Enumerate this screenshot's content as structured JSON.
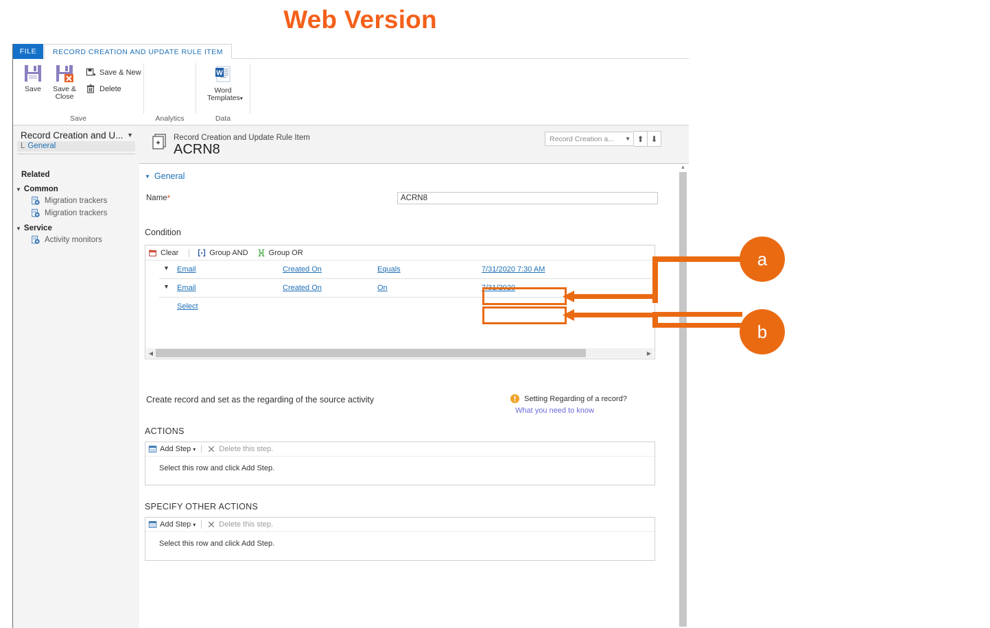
{
  "page": {
    "heading": "Web Version"
  },
  "ribbon": {
    "tabs": [
      {
        "id": "file",
        "label": "FILE"
      },
      {
        "id": "main",
        "label": "RECORD CREATION AND UPDATE RULE ITEM"
      }
    ],
    "buttons": {
      "save": "Save",
      "save_and_close_line1": "Save &",
      "save_and_close_line2": "Close",
      "save_and_new": "Save & New",
      "delete": "Delete",
      "word_templates_line1": "Word",
      "word_templates_line2": "Templates"
    },
    "groups": {
      "save": "Save",
      "analytics": "Analytics",
      "data": "Data"
    }
  },
  "nav": {
    "title": "Record Creation and U...",
    "selected_prefix": "L",
    "selected": "General",
    "related_label": "Related",
    "groups": [
      {
        "label": "Common",
        "items": [
          {
            "label": "Migration trackers",
            "icon": "record-lock-icon"
          },
          {
            "label": "Migration trackers",
            "icon": "record-lock-icon"
          }
        ]
      },
      {
        "label": "Service",
        "items": [
          {
            "label": "Activity monitors",
            "icon": "record-lock-icon"
          }
        ]
      }
    ]
  },
  "form": {
    "entity_label": "Record Creation and Update Rule Item",
    "record_title": "ACRN8",
    "lookup_value": "Record Creation a...",
    "section_general": "General",
    "name_label": "Name",
    "name_required_mark": "*",
    "name_value": "ACRN8",
    "condition_label": "Condition",
    "condition_toolbar": [
      {
        "id": "clear",
        "label": "Clear",
        "icon": "clear-icon"
      },
      {
        "id": "group-and",
        "label": "Group AND",
        "icon": "group-and-icon"
      },
      {
        "id": "group-or",
        "label": "Group OR",
        "icon": "group-or-icon"
      }
    ],
    "condition_rows": [
      {
        "entity": "Email",
        "field": "Created On",
        "operator": "Equals",
        "value": "7/31/2020 7:30 AM"
      },
      {
        "entity": "Email",
        "field": "Created On",
        "operator": "On",
        "value": "7/31/2020"
      }
    ],
    "condition_select_row": "Select",
    "regarding_text": "Create record and set as the regarding of the source activity",
    "warning_text": "Setting Regarding of a record?",
    "warning_link": "What you need to know",
    "actions_heading": "ACTIONS",
    "other_actions_heading": "SPECIFY OTHER ACTIONS",
    "add_step_label": "Add Step",
    "delete_step_label": "Delete this step.",
    "empty_step_text": "Select this row and click Add Step."
  },
  "annotations": {
    "accent": "#EA6A12",
    "callouts": [
      {
        "id": "a",
        "label": "a"
      },
      {
        "id": "b",
        "label": "b"
      }
    ]
  },
  "colors": {
    "file_tab_blue": "#1571C8",
    "link_blue": "#1d6fb5",
    "title_orange": "#F4601A"
  }
}
